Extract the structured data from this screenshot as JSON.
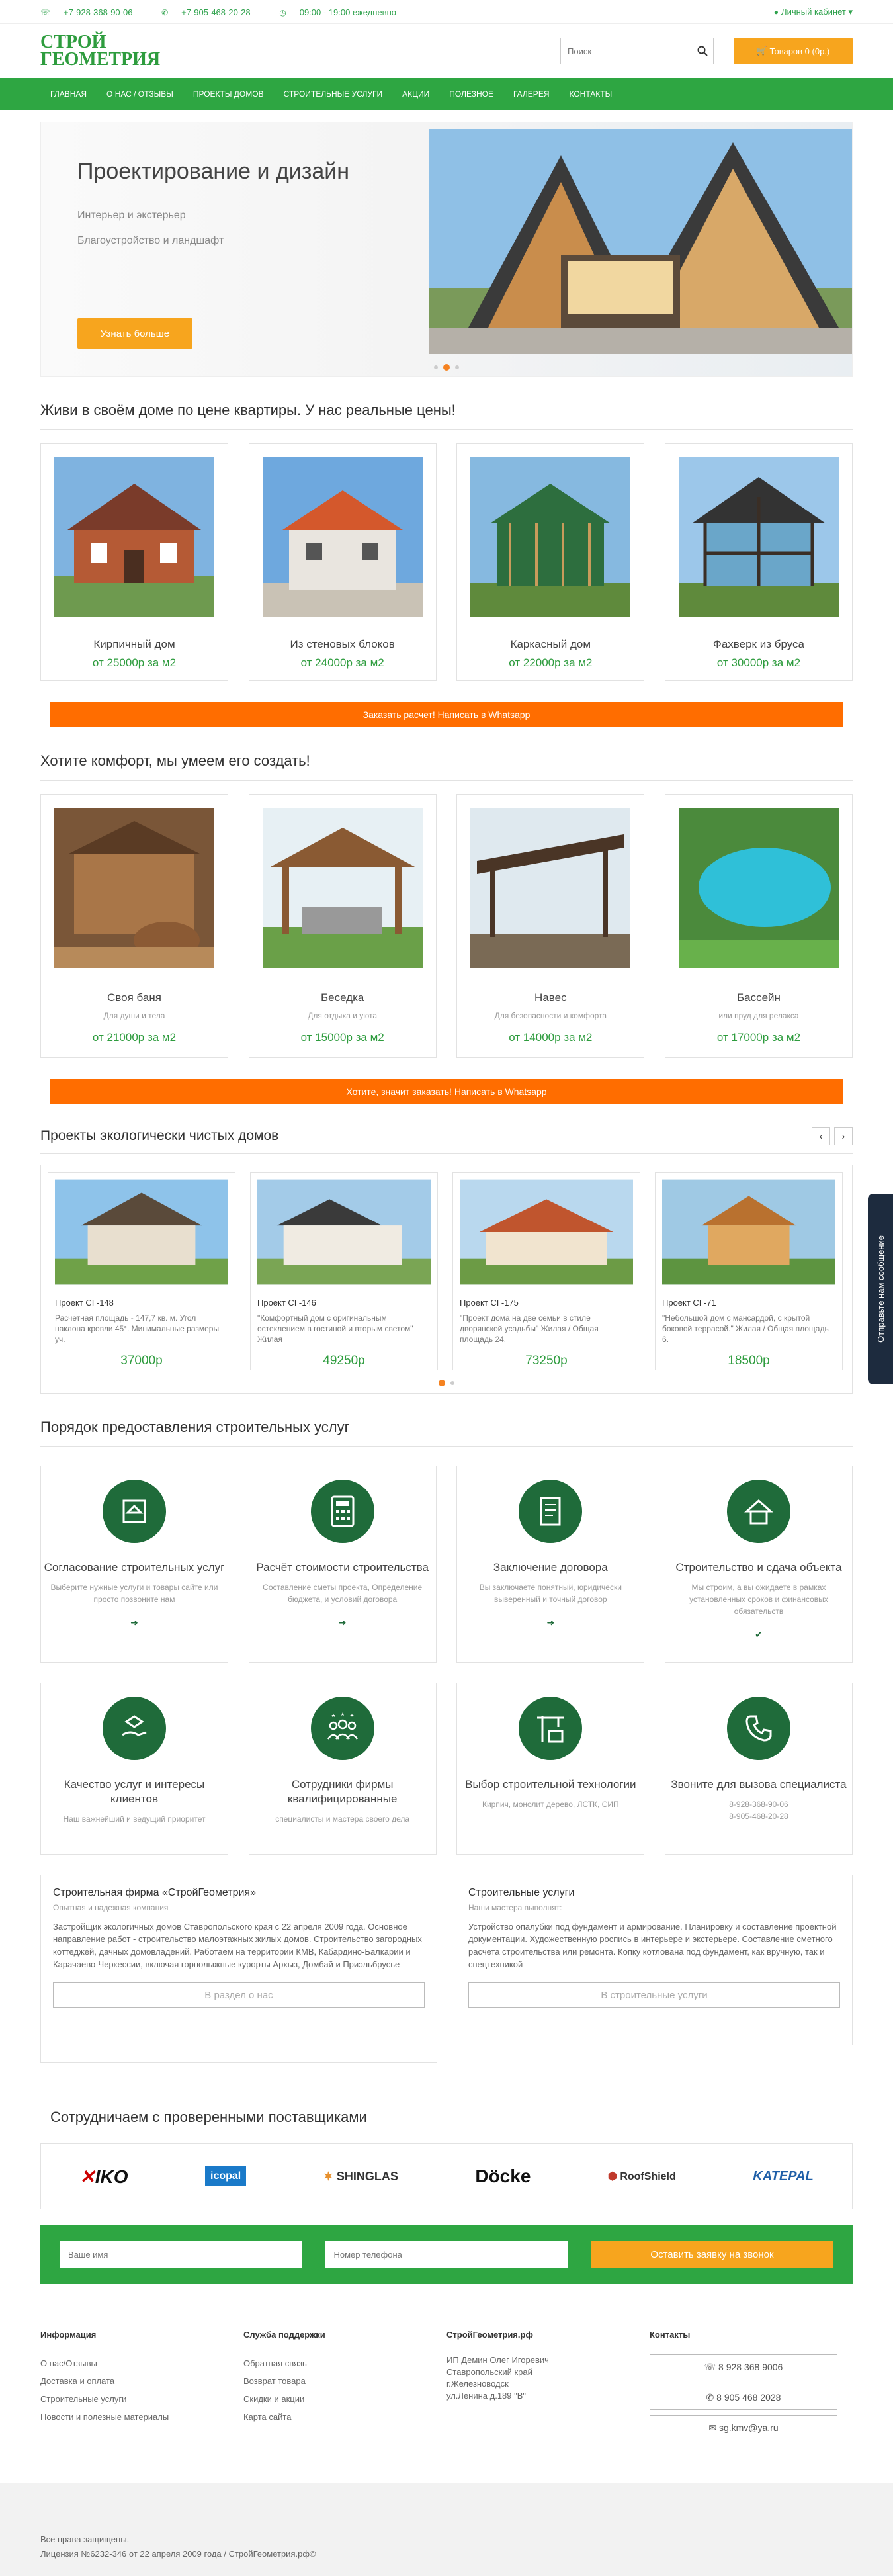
{
  "topbar": {
    "phone1": "+7-928-368-90-06",
    "phone2": "+7-905-468-20-28",
    "hours": "09:00 - 19:00 ежедневно",
    "account": "Личный кабинет ▾"
  },
  "header": {
    "logo_line1": "СТРОЙ",
    "logo_line2": "ГЕОМЕТРИЯ",
    "search_placeholder": "Поиск",
    "cart": "Товаров 0 (0р.)"
  },
  "nav": [
    "ГЛАВНАЯ",
    "О НАС / ОТЗЫВЫ",
    "ПРОЕКТЫ ДОМОВ",
    "СТРОИТЕЛЬНЫЕ УСЛУГИ",
    "АКЦИИ",
    "ПОЛЕЗНОЕ",
    "ГАЛЕРЕЯ",
    "КОНТАКТЫ"
  ],
  "slider": {
    "title": "Проектирование и дизайн",
    "sub1": "Интерьер и экстерьер",
    "sub2": "Благоустройство и ландшафт",
    "button": "Узнать больше"
  },
  "houses": {
    "title": "Живи в своём доме по цене квартиры. У нас реальные цены!",
    "items": [
      {
        "name": "Кирпичный дом",
        "price": "от 25000р за м2"
      },
      {
        "name": "Из стеновых блоков",
        "price": "от 24000р за м2"
      },
      {
        "name": "Каркасный дом",
        "price": "от 22000р за м2"
      },
      {
        "name": "Фахверк из бруса",
        "price": "от 30000р за м2"
      }
    ],
    "cta": "Заказать расчет! Написать в Whatsapp"
  },
  "comfort": {
    "title": "Хотите комфорт, мы умеем его создать!",
    "items": [
      {
        "name": "Своя баня",
        "desc": "Для души и тела",
        "price": "от 21000р за м2"
      },
      {
        "name": "Беседка",
        "desc": "Для отдыха и уюта",
        "price": "от 15000р за м2"
      },
      {
        "name": "Навес",
        "desc": "Для безопасности и комфорта",
        "price": "от 14000р за м2"
      },
      {
        "name": "Бассейн",
        "desc": "или пруд для релакса",
        "price": "от 17000р за м2"
      }
    ],
    "cta": "Хотите, значит заказать! Написать в Whatsapp"
  },
  "projects": {
    "title": "Проекты экологически чистых домов",
    "items": [
      {
        "name": "Проект СГ-148",
        "desc": "Расчетная площадь - 147,7 кв. м. Угол наклона кровли 45°. Минимальные размеры уч.",
        "price": "37000р"
      },
      {
        "name": "Проект СГ-146",
        "desc": "\"Комфортный дом с оригинальным остеклением в гостиной и вторым светом\" Жилая",
        "price": "49250р"
      },
      {
        "name": "Проект СГ-175",
        "desc": "\"Проект дома на две семьи в стиле дворянской усадьбы\" Жилая / Общая площадь 24.",
        "price": "73250р"
      },
      {
        "name": "Проект СГ-71",
        "desc": "\"Небольшой дом с мансардой, с крытой боковой террасой.\" Жилая / Общая площадь 6.",
        "price": "18500р"
      }
    ]
  },
  "process": {
    "title": "Порядок предоставления строительных услуг",
    "steps1": [
      {
        "title": "Согласование строительных услуг",
        "desc": "Выберите нужные услуги и товары сайте или просто позвоните нам"
      },
      {
        "title": "Расчёт стоимости строительства",
        "desc": "Составление сметы проекта, Определение бюджета, и условий договора"
      },
      {
        "title": "Заключение договора",
        "desc": "Вы заключаете понятный, юридически выверенный и точный договор"
      },
      {
        "title": "Строительство и сдача объекта",
        "desc": "Мы строим, а вы ожидаете в рамках установленных сроков и финансовых обязательств"
      }
    ],
    "steps2": [
      {
        "title": "Качество услуг и интересы клиентов",
        "desc": "Наш важнейший и ведущий приоритет"
      },
      {
        "title": "Сотрудники фирмы квалифицированные",
        "desc": "специалисты и мастера своего дела"
      },
      {
        "title": "Выбор строительной технологии",
        "desc": "Кирпич, монолит дерево, ЛСТК, СИП"
      },
      {
        "title": "Звоните для вызова специалиста",
        "desc": "8-928-368-90-06\n8-905-468-20-28"
      }
    ]
  },
  "about": {
    "title": "Строительная фирма «СтройГеометрия»",
    "sub": "Опытная и надежная компания",
    "text": "Застройщик экологичных домов Ставропольского края с 22 апреля 2009 года. Основное направление работ - строительство малоэтажных жилых домов. Строительство загородных коттеджей, дачных домовладений. Работаем на территории КМВ, Кабардино-Балкарии и Карачаево-Черкессии, включая горнолыжные курорты Архыз, Домбай и Приэльбрусье",
    "button": "В раздел о нас"
  },
  "services": {
    "title": "Строительные услуги",
    "sub": "Наши мастера выполнят:",
    "text": "Устройство опалубки под фундамент и армирование. Планировку и составление проектной документации. Художественную роспись в интерьере и экстерьере. Составление сметного расчета строительства или ремонта. Копку котлована под фундамент, как вручную, так и спецтехникой",
    "button": "В строительные услуги"
  },
  "partners": {
    "title": "Сотрудничаем с проверенными поставщиками",
    "logos": [
      "IKO",
      "icopal",
      "SHINGLAS",
      "Döcke",
      "RoofShield",
      "KATEPAL"
    ]
  },
  "form": {
    "name_placeholder": "Ваше имя",
    "phone_placeholder": "Номер телефона",
    "button": "Оставить заявку на звонок"
  },
  "footer": {
    "col1_title": "Информация",
    "col1": [
      "О нас/Отзывы",
      "Доставка и оплата",
      "Строительные услуги",
      "Новости и полезные материалы"
    ],
    "col2_title": "Служба поддержки",
    "col2": [
      "Обратная связь",
      "Возврат товара",
      "Скидки и акции",
      "Карта сайта"
    ],
    "col3_title": "СтройГеометрия.рф",
    "col3": [
      "ИП Демин Олег Игоревич",
      "Ставропольский край",
      "г.Железноводск",
      "ул.Ленина д.189 \"В\""
    ],
    "col4_title": "Контакты",
    "phone1": "8 928 368 9006",
    "phone2": "8 905 468 2028",
    "email": "sg.kmv@ya.ru",
    "rights": "Все права защищены.",
    "license": "Лицензия №6232-346 от 22 апреля 2009 года / СтройГеометрия.рф©"
  },
  "sidetab": "Отправьте нам сообщение",
  "colors": {
    "green": "#2ea642",
    "orange": "#ff6d00",
    "accent": "#f7a51e",
    "darkgreen": "#1f6b3a"
  }
}
